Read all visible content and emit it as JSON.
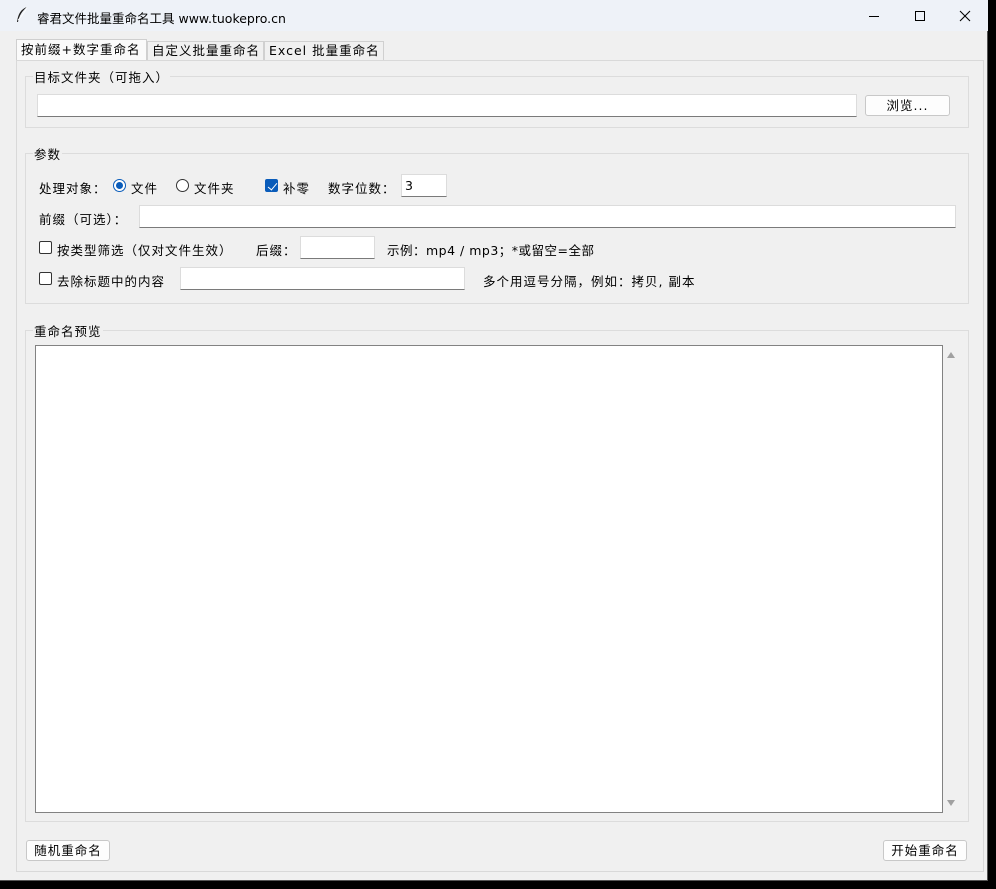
{
  "window": {
    "title": "睿君文件批量重命名工具  www.tuokepro.cn",
    "controls": {
      "minimize": "minimize-icon",
      "maximize": "maximize-icon",
      "close": "close-icon"
    }
  },
  "tabs": [
    {
      "label": "按前缀+数字重命名",
      "active": true
    },
    {
      "label": "自定义批量重命名",
      "active": false
    },
    {
      "label": "Excel 批量重命名",
      "active": false
    }
  ],
  "folder_group": {
    "label": "目标文件夹（可拖入）",
    "path_value": "",
    "browse_label": "浏览..."
  },
  "params_group": {
    "label": "参数",
    "target_label": "处理对象：",
    "radio_file": "文件",
    "radio_folder": "文件夹",
    "selected_target": "文件",
    "zero_pad_label": "补零",
    "zero_pad_checked": true,
    "digits_label": "数字位数：",
    "digits_value": "3",
    "prefix_label": "前缀（可选）：",
    "prefix_value": "",
    "filter_label": "按类型筛选（仅对文件生效）",
    "filter_checked": false,
    "suffix_label": "后缀：",
    "suffix_value": "",
    "suffix_hint": "示例：mp4 / mp3；*或留空=全部",
    "remove_label": "去除标题中的内容",
    "remove_checked": false,
    "remove_value": "",
    "remove_hint": "多个用逗号分隔，例如：拷贝, 副本"
  },
  "preview_group": {
    "label": "重命名预览",
    "content": ""
  },
  "footer": {
    "random_label": "随机重命名",
    "start_label": "开始重命名"
  }
}
